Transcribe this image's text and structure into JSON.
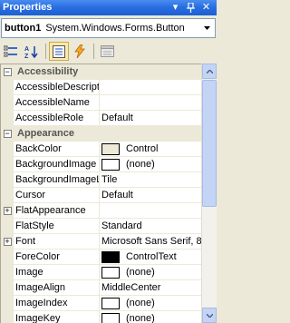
{
  "window": {
    "title": "Properties",
    "pin_glyph": "▾",
    "autohide_glyph": "ϯ",
    "close_glyph": "✕"
  },
  "selector": {
    "object_name": "button1",
    "object_type": "System.Windows.Forms.Button"
  },
  "toolbar": {
    "buttons": [
      "categorized-icon",
      "alphabetical-icon",
      "properties-icon",
      "events-icon",
      "property-pages-icon"
    ],
    "active": "properties-icon"
  },
  "grid": {
    "cat_accessibility": {
      "label": "Accessibility",
      "expander": "−"
    },
    "accessible_description": {
      "name": "AccessibleDescriptio",
      "value": ""
    },
    "accessible_name": {
      "name": "AccessibleName",
      "value": ""
    },
    "accessible_role": {
      "name": "AccessibleRole",
      "value": "Default"
    },
    "cat_appearance": {
      "label": "Appearance",
      "expander": "−"
    },
    "back_color": {
      "name": "BackColor",
      "value": "Control",
      "swatch": "#ece9d8"
    },
    "background_image": {
      "name": "BackgroundImage",
      "value": "(none)",
      "swatch": "#ffffff"
    },
    "background_image_layout": {
      "name": "BackgroundImageL",
      "value": "Tile"
    },
    "cursor": {
      "name": "Cursor",
      "value": "Default"
    },
    "flat_appearance": {
      "name": "FlatAppearance",
      "value": "",
      "expander": "+"
    },
    "flat_style": {
      "name": "FlatStyle",
      "value": "Standard"
    },
    "font": {
      "name": "Font",
      "value": "Microsoft Sans Serif, 8",
      "expander": "+"
    },
    "fore_color": {
      "name": "ForeColor",
      "value": "ControlText",
      "swatch": "#000000"
    },
    "image": {
      "name": "Image",
      "value": "(none)",
      "swatch": "#ffffff"
    },
    "image_align": {
      "name": "ImageAlign",
      "value": "MiddleCenter"
    },
    "image_index": {
      "name": "ImageIndex",
      "value": "(none)",
      "swatch": "#ffffff"
    },
    "image_key": {
      "name": "ImageKey",
      "value": "(none)",
      "swatch": "#ffffff"
    }
  },
  "colors": {
    "titlebar": "#2a6fe0",
    "category_bg": "#ece9d8",
    "scrollbar": "#c4d4f4"
  }
}
